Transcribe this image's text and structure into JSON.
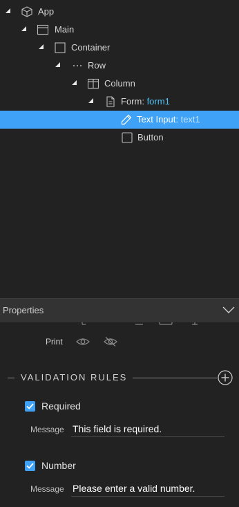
{
  "tree": {
    "items": [
      {
        "label": "App",
        "ref": "",
        "icon": "cube-icon"
      },
      {
        "label": "Main",
        "ref": "",
        "icon": "window-icon"
      },
      {
        "label": "Container",
        "ref": "",
        "icon": "square-icon"
      },
      {
        "label": "Row",
        "ref": "",
        "icon": "ellipsis-icon"
      },
      {
        "label": "Column",
        "ref": "",
        "icon": "columns-icon"
      },
      {
        "label": "Form: ",
        "ref": "form1",
        "icon": "document-icon"
      },
      {
        "label": "Text Input: ",
        "ref": "text1",
        "icon": "pencil-icon",
        "selected": true
      },
      {
        "label": "Button",
        "ref": "",
        "icon": "checkbox-icon"
      }
    ]
  },
  "properties": {
    "title": "Properties",
    "print_label": "Print",
    "validation_title": "VALIDATION RULES",
    "rules": [
      {
        "checked": true,
        "label": "Required",
        "message_label": "Message",
        "message": "This field is required."
      },
      {
        "checked": true,
        "label": "Number",
        "message_label": "Message",
        "message": "Please enter a valid number."
      }
    ]
  },
  "colors": {
    "selection": "#3fa2f7",
    "ref": "#4fc3f7",
    "background": "#222222",
    "header": "#333333"
  }
}
